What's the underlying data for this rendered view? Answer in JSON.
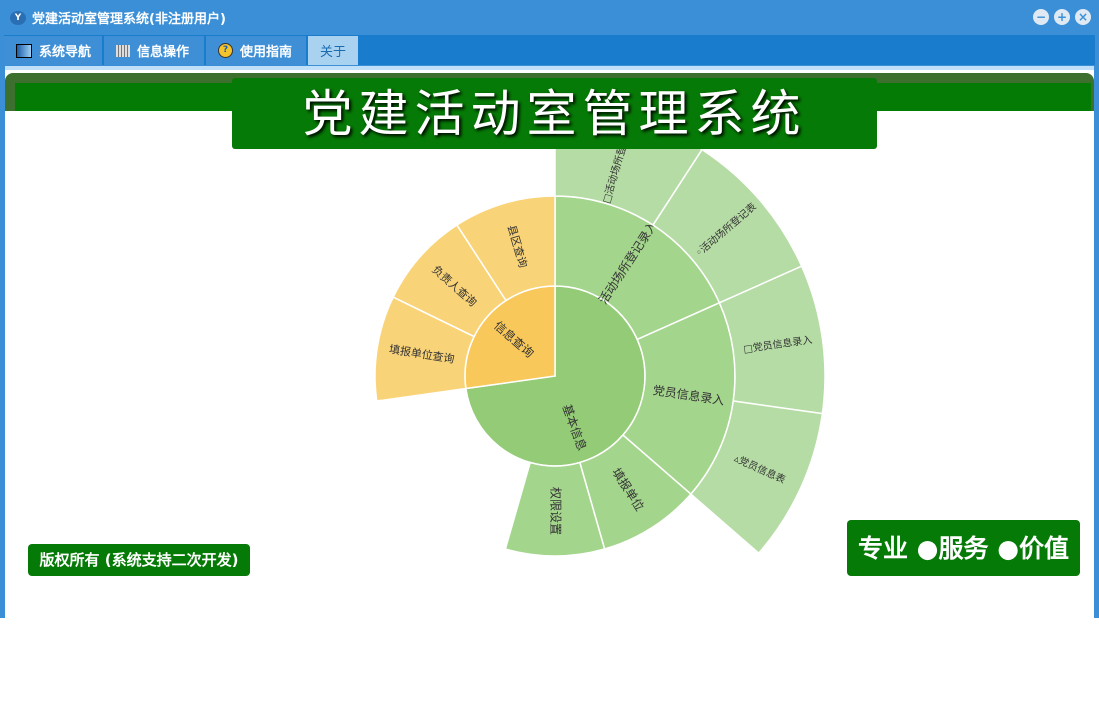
{
  "window": {
    "title": "党建活动室管理系统(非注册用户)",
    "logo_text": "Y"
  },
  "tabs": [
    {
      "label": "系统导航",
      "icon": "monitor-icon"
    },
    {
      "label": "信息操作",
      "icon": "grid-icon"
    },
    {
      "label": "使用指南",
      "icon": "help-icon"
    },
    {
      "label": "关于",
      "active": true
    }
  ],
  "banner": "党建活动室管理系统",
  "copyright": "版权所有 (系统支持二次开发)",
  "slogan": "专业 ●服务 ●价值",
  "colors": {
    "inner_green": "#93cb76",
    "mid_green": "#a4d58c",
    "outer_green": "#b5dca4",
    "inner_yellow": "#f8c85a",
    "outer_yellow": "#f9d378",
    "header_green": "#067a06"
  },
  "chart_data": {
    "type": "sunburst",
    "unit": "degrees",
    "rings": [
      [
        {
          "label": "基本信息",
          "start": 0,
          "end": 262,
          "color": "#93cb76"
        },
        {
          "label": "信息查询",
          "start": 262,
          "end": 360,
          "color": "#f8c85a"
        }
      ],
      [
        {
          "label": "活动场所登记录入",
          "start": 0,
          "end": 66,
          "color": "#a4d58c"
        },
        {
          "label": "党员信息录入",
          "start": 66,
          "end": 131,
          "color": "#a4d58c"
        },
        {
          "label": "填报单位",
          "start": 131,
          "end": 164,
          "color": "#a4d58c"
        },
        {
          "label": "权限设置",
          "start": 164,
          "end": 196,
          "color": "#a4d58c"
        },
        {
          "label": "填报单位查询",
          "start": 262,
          "end": 296,
          "color": "#f9d378"
        },
        {
          "label": "负责人查询",
          "start": 296,
          "end": 327,
          "color": "#f9d378"
        },
        {
          "label": "县区查询",
          "start": 327,
          "end": 360,
          "color": "#f9d378"
        }
      ],
      [
        {
          "label": "□活动场所登记录入",
          "start": 0,
          "end": 33,
          "color": "#b5dca4"
        },
        {
          "label": "◦活动场所登记表",
          "start": 33,
          "end": 66,
          "color": "#b5dca4"
        },
        {
          "label": "□党员信息录入",
          "start": 66,
          "end": 98,
          "color": "#b5dca4"
        },
        {
          "label": "▵党员信息表",
          "start": 98,
          "end": 131,
          "color": "#b5dca4"
        }
      ]
    ]
  }
}
